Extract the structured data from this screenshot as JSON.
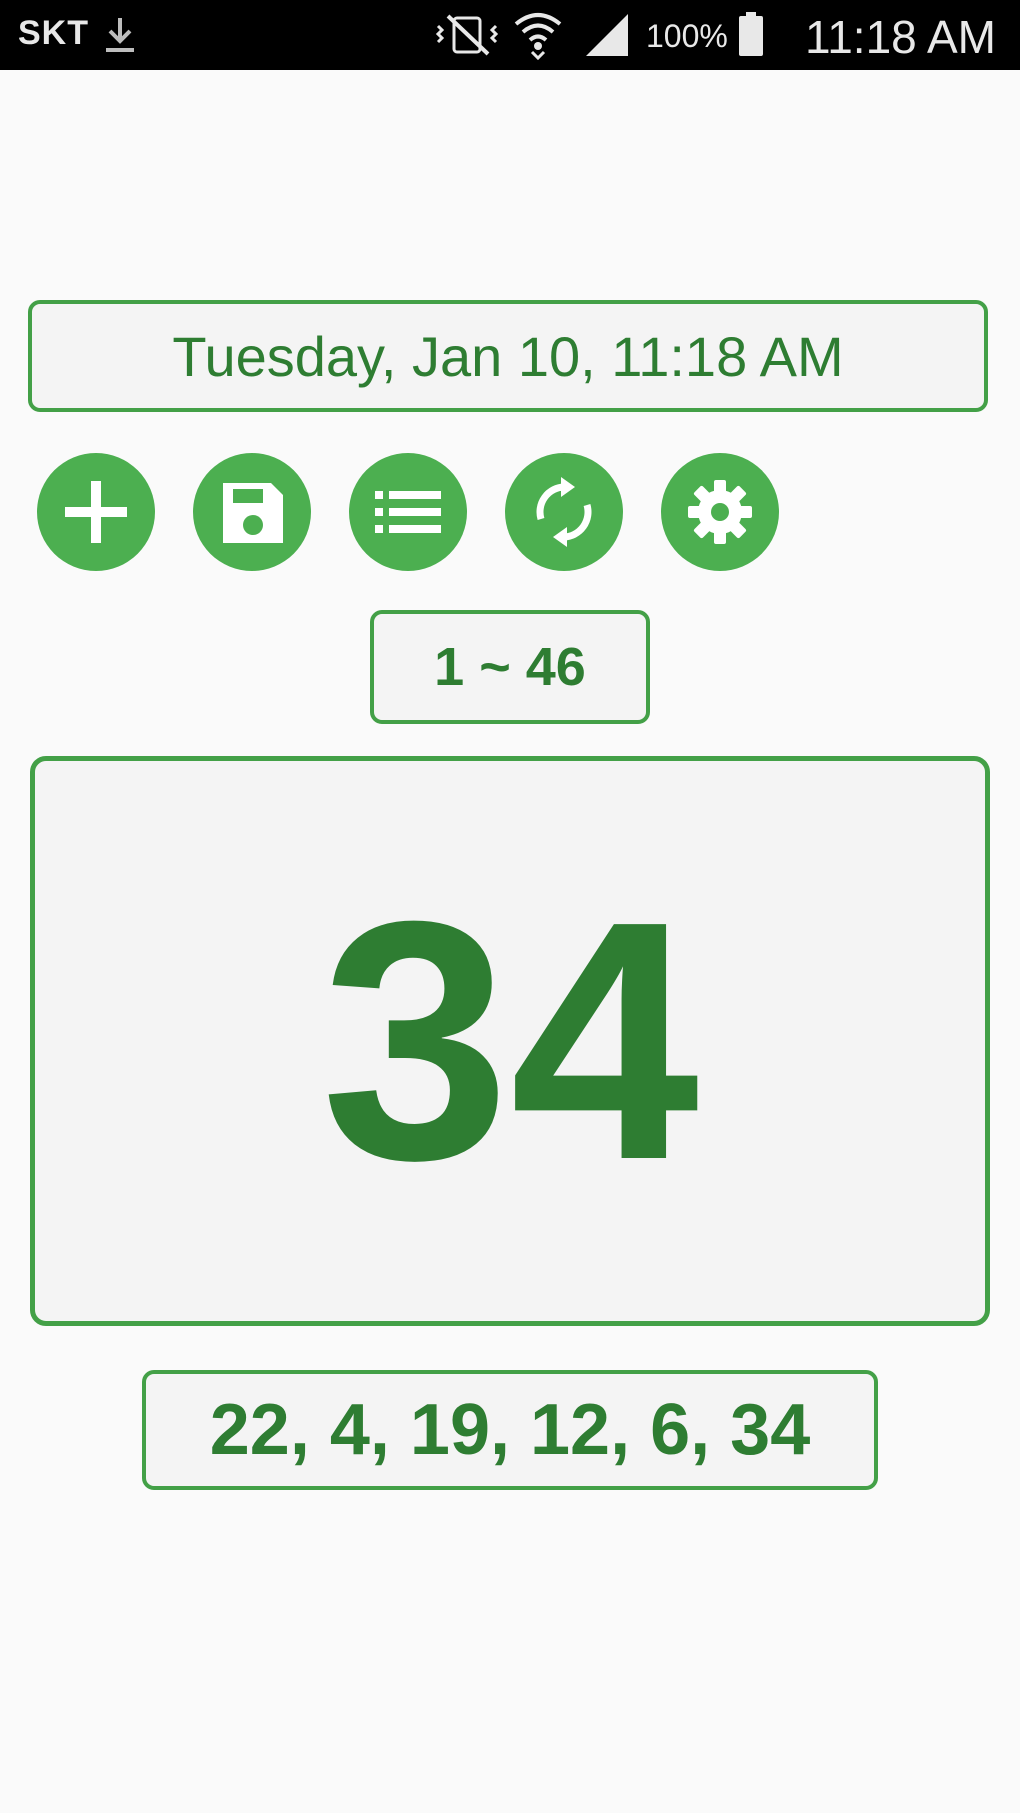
{
  "status_bar": {
    "carrier": "SKT",
    "battery_percent": "100%",
    "time": "11:18 AM",
    "icons": [
      "download-icon",
      "vibrate-icon",
      "wifi-icon",
      "signal-icon",
      "battery-icon"
    ]
  },
  "datetime_display": "Tuesday, Jan 10, 11:18 AM",
  "toolbar": {
    "buttons": [
      {
        "icon": "plus-icon"
      },
      {
        "icon": "save-icon"
      },
      {
        "icon": "list-icon"
      },
      {
        "icon": "refresh-icon"
      },
      {
        "icon": "gear-icon"
      }
    ]
  },
  "range_display": "1 ~ 46",
  "current_number": "34",
  "history": "22, 4, 19, 12, 6, 34",
  "colors": {
    "accent": "#4caf50",
    "border": "#43a047",
    "text": "#2e7d32",
    "background": "#fafafa",
    "box_background": "#f4f4f4",
    "status_bar": "#000000"
  }
}
